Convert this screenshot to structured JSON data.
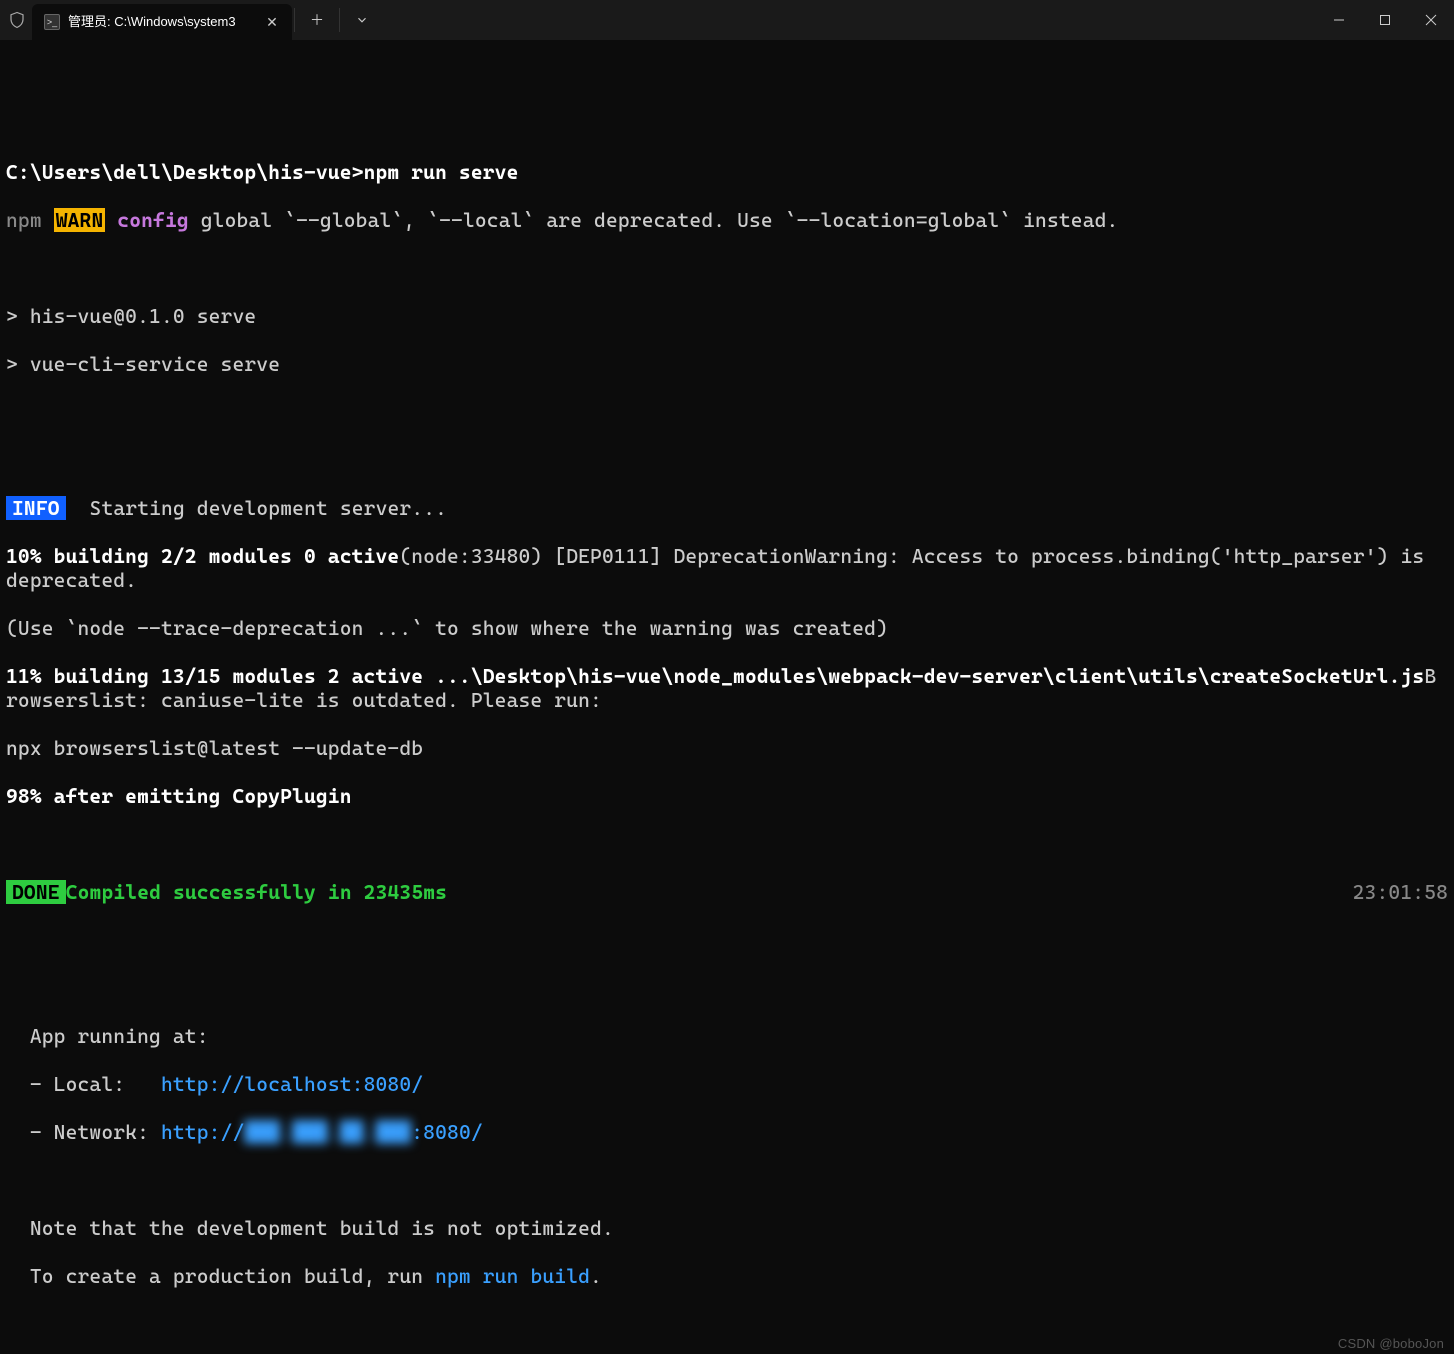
{
  "window": {
    "title": "管理员: C:\\Windows\\system3",
    "tab_icon_glyph": ">_"
  },
  "prompt": "C:\\Users\\dell\\Desktop\\his-vue>",
  "command": "npm run serve",
  "npm": {
    "prefix": "npm",
    "warn": "WARN",
    "config": "config",
    "tail": " global `--global`, `--local` are deprecated. Use `--location=global` instead."
  },
  "script_lines": [
    "> his-vue@0.1.0 serve",
    "> vue-cli-service serve"
  ],
  "info_label": "INFO",
  "info_text": "Starting development server...",
  "build1": {
    "bold": "10% building 2/2 modules 0 active",
    "tail": "(node:33480) [DEP0111] DeprecationWarning: Access to process.binding('http_parser') is deprecated."
  },
  "build1_trace": "(Use `node --trace-deprecation ...` to show where the warning was created)",
  "build2": {
    "bold": "11% building 13/15 modules 2 active ...\\Desktop\\his-vue\\node_modules\\webpack-dev-server\\client\\utils\\createSocketUrl.js",
    "tail": "Browserslist: caniuse-lite is outdated. Please run:"
  },
  "browserslist_fix": "npx browserslist@latest --update-db",
  "build3": "98% after emitting CopyPlugin",
  "done_label": "DONE",
  "done_text": "Compiled successfully in 23435ms",
  "done_time": "23:01:58",
  "app": {
    "running": "  App running at:",
    "local_label": "  - Local:   ",
    "local_url": "http://localhost:8080/",
    "network_label": "  - Network: ",
    "network_url_pre": "http://",
    "network_ip": "███.███.██.███",
    "network_url_post": ":8080/"
  },
  "note1": "  Note that the development build is not optimized.",
  "note2_pre": "  To create a production build, run ",
  "note2_cmd": "npm run build",
  "note2_post": ".",
  "watermark": "CSDN @boboJon"
}
